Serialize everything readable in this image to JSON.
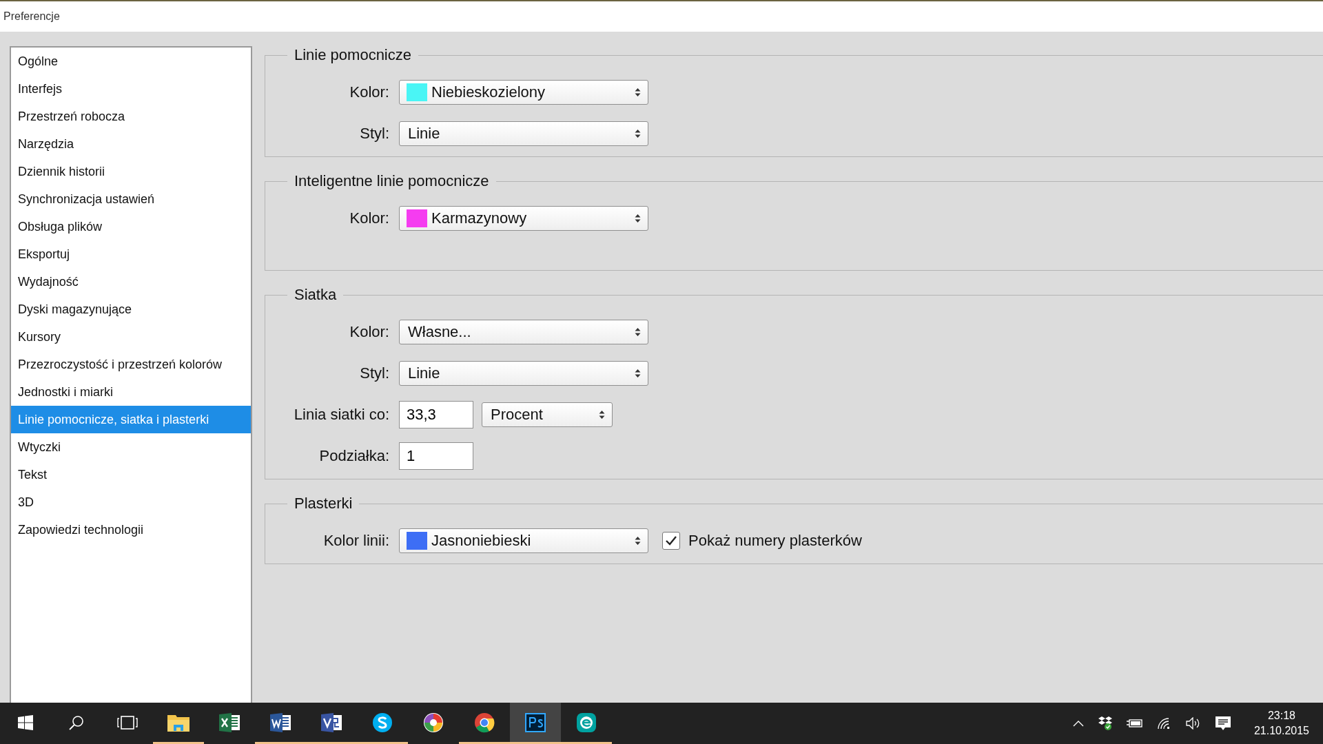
{
  "window": {
    "title": "Preferencje"
  },
  "sidebar": {
    "items": [
      {
        "label": "Ogólne",
        "selected": false
      },
      {
        "label": "Interfejs",
        "selected": false
      },
      {
        "label": "Przestrzeń robocza",
        "selected": false
      },
      {
        "label": "Narzędzia",
        "selected": false
      },
      {
        "label": "Dziennik historii",
        "selected": false
      },
      {
        "label": "Synchronizacja ustawień",
        "selected": false
      },
      {
        "label": "Obsługa plików",
        "selected": false
      },
      {
        "label": "Eksportuj",
        "selected": false
      },
      {
        "label": "Wydajność",
        "selected": false
      },
      {
        "label": "Dyski magazynujące",
        "selected": false
      },
      {
        "label": "Kursory",
        "selected": false
      },
      {
        "label": "Przezroczystość i przestrzeń kolorów",
        "selected": false
      },
      {
        "label": "Jednostki i miarki",
        "selected": false
      },
      {
        "label": "Linie pomocnicze, siatka i plasterki",
        "selected": true
      },
      {
        "label": "Wtyczki",
        "selected": false
      },
      {
        "label": "Tekst",
        "selected": false
      },
      {
        "label": "3D",
        "selected": false
      },
      {
        "label": "Zapowiedzi technologii",
        "selected": false
      }
    ]
  },
  "sections": [
    {
      "title": "Linie pomocnicze",
      "rows": [
        {
          "label": "Kolor:",
          "controls": [
            {
              "kind": "select",
              "value": "Niebieskozielony",
              "color": "#4af5f5"
            }
          ]
        },
        {
          "label": "Styl:",
          "controls": [
            {
              "kind": "select",
              "value": "Linie"
            }
          ]
        }
      ]
    },
    {
      "title": "Inteligentne linie pomocnicze",
      "rows": [
        {
          "label": "Kolor:",
          "controls": [
            {
              "kind": "select",
              "value": "Karmazynowy",
              "color": "#f53cf0"
            }
          ]
        }
      ]
    },
    {
      "title": "Siatka",
      "rows": [
        {
          "label": "Kolor:",
          "controls": [
            {
              "kind": "select",
              "value": "Własne..."
            }
          ]
        },
        {
          "label": "Styl:",
          "controls": [
            {
              "kind": "select",
              "value": "Linie"
            }
          ]
        },
        {
          "label": "Linia siatki co:",
          "controls": [
            {
              "kind": "input",
              "value": "33,3"
            },
            {
              "kind": "unit",
              "value": "Procent"
            }
          ]
        },
        {
          "label": "Podziałka:",
          "controls": [
            {
              "kind": "input",
              "value": "1"
            }
          ]
        }
      ]
    },
    {
      "title": "Plasterki",
      "rows": [
        {
          "label": "Kolor linii:",
          "controls": [
            {
              "kind": "select",
              "value": "Jasnoniebieski",
              "color": "#3d6ef5"
            },
            {
              "kind": "checkbox",
              "label": "Pokaż numery plasterków",
              "checked": true
            }
          ]
        }
      ]
    }
  ],
  "taskbar": {
    "apps": [
      {
        "kind": "start",
        "running": false,
        "active": false
      },
      {
        "kind": "search",
        "running": false,
        "active": false
      },
      {
        "kind": "taskview",
        "running": false,
        "active": false
      },
      {
        "kind": "explorer",
        "running": true,
        "active": false
      },
      {
        "kind": "excel",
        "running": false,
        "active": false
      },
      {
        "kind": "word",
        "running": true,
        "active": false
      },
      {
        "kind": "visio",
        "running": true,
        "active": false
      },
      {
        "kind": "skype",
        "running": true,
        "active": false
      },
      {
        "kind": "picasa",
        "running": false,
        "active": false
      },
      {
        "kind": "chrome",
        "running": true,
        "active": false
      },
      {
        "kind": "photoshop",
        "running": true,
        "active": true
      },
      {
        "kind": "eset",
        "running": true,
        "active": false
      }
    ],
    "time": "23:18",
    "date": "21.10.2015"
  }
}
